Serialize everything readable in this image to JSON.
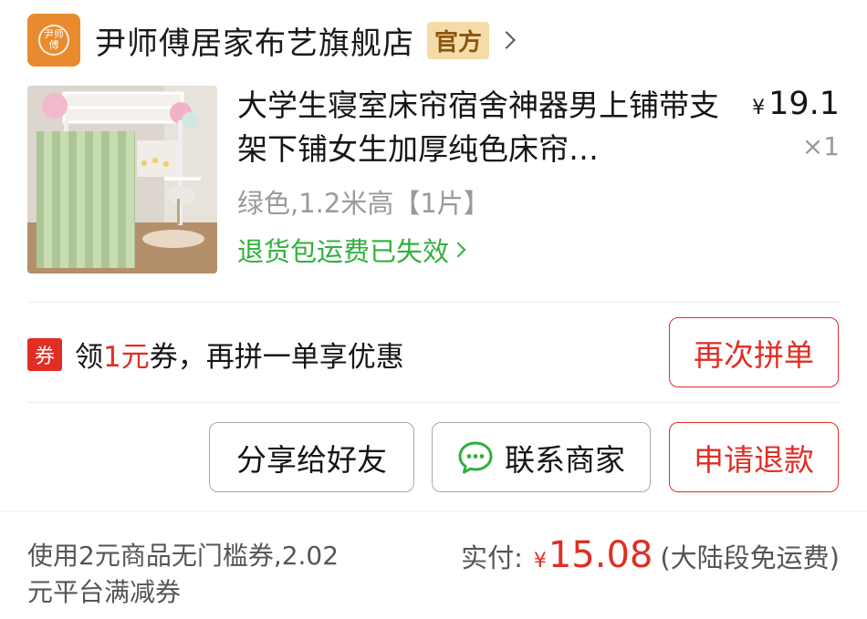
{
  "store": {
    "logo_text": "尹师傅",
    "name": "尹师傅居家布艺旗舰店",
    "badge": "官方"
  },
  "product": {
    "title": "大学生寝室床帘宿舍神器男上铺带支架下铺女生加厚纯色床帘…",
    "currency": "¥",
    "price": "19.1",
    "quantity": "×1",
    "spec": "绿色,1.2米高【1片】",
    "return_status": "退货包运费已失效"
  },
  "coupon": {
    "tag": "券",
    "text_prefix": "领",
    "text_amount": "1元",
    "text_suffix": "券，再拼一单享优惠"
  },
  "actions": {
    "rebuy": "再次拼单",
    "share": "分享给好友",
    "contact": "联系商家",
    "refund": "申请退款"
  },
  "footer": {
    "discount_note": "使用2元商品无门槛券,2.02元平台满减券",
    "paid_label": "实付:",
    "paid_currency": "¥",
    "paid_amount": "15.08",
    "shipping_note": "(大陆段免运费)"
  },
  "colors": {
    "accent_red": "#e02e24",
    "success_green": "#2fb13c",
    "store_orange": "#e98a2e",
    "badge_gold": "#f5dba8"
  },
  "icons": {
    "store": "store-logo-icon",
    "store_chevron": "chevron-right-icon",
    "return_chevron": "chevron-right-icon",
    "chat": "chat-bubble-icon"
  }
}
